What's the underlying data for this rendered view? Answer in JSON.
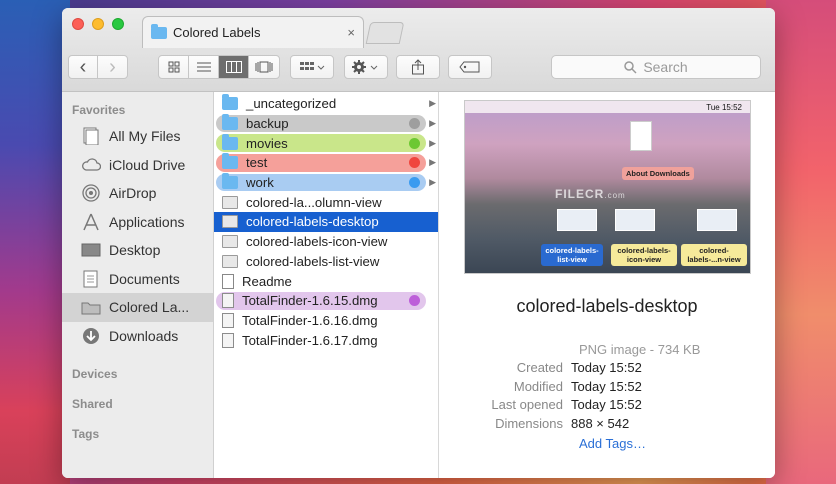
{
  "window": {
    "tab_title": "Colored Labels",
    "tab_close": "×"
  },
  "toolbar": {
    "search_placeholder": "Search",
    "back_icon": "‹",
    "forward_icon": "›"
  },
  "sidebar": {
    "favorites_header": "Favorites",
    "items": [
      {
        "label": "All My Files",
        "icon": "all-files-icon"
      },
      {
        "label": "iCloud Drive",
        "icon": "cloud-icon"
      },
      {
        "label": "AirDrop",
        "icon": "airdrop-icon"
      },
      {
        "label": "Applications",
        "icon": "applications-icon"
      },
      {
        "label": "Desktop",
        "icon": "desktop-icon"
      },
      {
        "label": "Documents",
        "icon": "documents-icon"
      },
      {
        "label": "Colored La...",
        "icon": "folder-icon",
        "active": true
      },
      {
        "label": "Downloads",
        "icon": "downloads-icon"
      }
    ],
    "devices_header": "Devices",
    "shared_header": "Shared",
    "tags_header": "Tags"
  },
  "column": {
    "rows": [
      {
        "name": "_uncategorized",
        "kind": "folder",
        "arrow": true
      },
      {
        "name": "backup",
        "kind": "folder",
        "label_color": "#c9c9c9",
        "dot": "#9e9e9e",
        "arrow": true
      },
      {
        "name": "movies",
        "kind": "folder",
        "label_color": "#c9e68a",
        "dot": "#6cc832",
        "arrow": true
      },
      {
        "name": "test",
        "kind": "folder",
        "label_color": "#f5a09a",
        "dot": "#f0463e",
        "arrow": true
      },
      {
        "name": "work",
        "kind": "folder",
        "label_color": "#a9ccf2",
        "dot": "#3a9bf0",
        "arrow": true
      },
      {
        "name": "colored-la...olumn-view",
        "kind": "image"
      },
      {
        "name": "colored-labels-desktop",
        "kind": "image",
        "selected": true
      },
      {
        "name": "colored-labels-icon-view",
        "kind": "image"
      },
      {
        "name": "colored-labels-list-view",
        "kind": "image"
      },
      {
        "name": "Readme",
        "kind": "doc"
      },
      {
        "name": "TotalFinder-1.6.15.dmg",
        "kind": "dmg",
        "label_color": "#e2c6ec",
        "dot": "#bd5fd9"
      },
      {
        "name": "TotalFinder-1.6.16.dmg",
        "kind": "dmg"
      },
      {
        "name": "TotalFinder-1.6.17.dmg",
        "kind": "dmg"
      }
    ]
  },
  "preview": {
    "thumb_time": "Tue 15:52",
    "thumb_labels": [
      "About Downloads",
      "colored-labels-list-view",
      "colored-labels-icon-view",
      "colored-labels-...n-view"
    ],
    "watermark": "FILECR",
    "watermark_sub": ".com",
    "filename": "colored-labels-desktop",
    "kind": "PNG image - 734 KB",
    "meta": [
      {
        "key": "Created",
        "value": "Today 15:52"
      },
      {
        "key": "Modified",
        "value": "Today 15:52"
      },
      {
        "key": "Last opened",
        "value": "Today 15:52"
      },
      {
        "key": "Dimensions",
        "value": "888 × 542"
      }
    ],
    "add_tags": "Add Tags…"
  }
}
